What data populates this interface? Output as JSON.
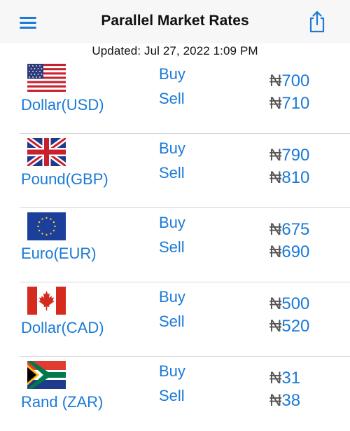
{
  "header": {
    "title": "Parallel Market Rates",
    "menu_icon": "hamburger-menu-icon",
    "share_icon": "share-icon"
  },
  "updated": "Updated: Jul 27, 2022 1:09 PM",
  "currency_symbol": "₦",
  "colors": {
    "accent": "#1a7ad6",
    "navbar_bg": "#f7f7f7",
    "divider": "#d6d6d6"
  },
  "rates": [
    {
      "name": "Dollar(USD)",
      "flag": "us-flag-icon",
      "buy_label": "Buy",
      "sell_label": "Sell",
      "buy": "700",
      "sell": "710"
    },
    {
      "name": "Pound(GBP)",
      "flag": "uk-flag-icon",
      "buy_label": "Buy",
      "sell_label": "Sell",
      "buy": "790",
      "sell": "810"
    },
    {
      "name": "Euro(EUR)",
      "flag": "eu-flag-icon",
      "buy_label": "Buy",
      "sell_label": "Sell",
      "buy": "675",
      "sell": "690"
    },
    {
      "name": "Dollar(CAD)",
      "flag": "canada-flag-icon",
      "buy_label": "Buy",
      "sell_label": "Sell",
      "buy": "500",
      "sell": "520"
    },
    {
      "name": "Rand (ZAR)",
      "flag": "south-africa-flag-icon",
      "buy_label": "Buy",
      "sell_label": "Sell",
      "buy": "31",
      "sell": "38"
    }
  ]
}
